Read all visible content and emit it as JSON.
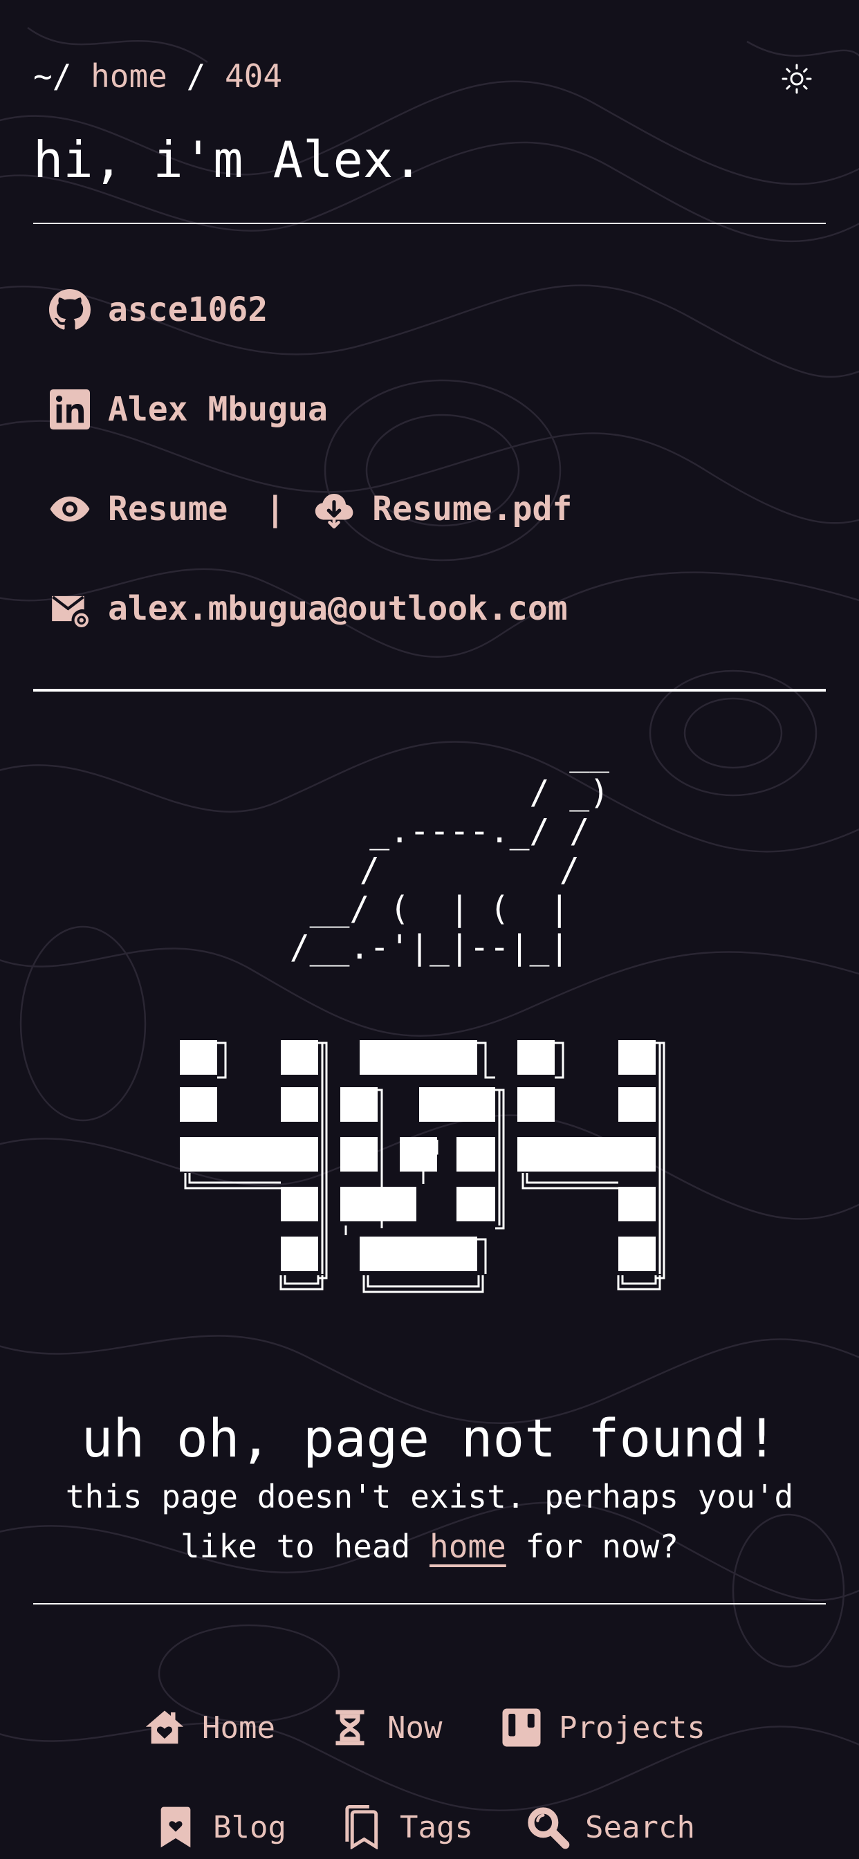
{
  "colors": {
    "background": "#12101a",
    "accent": "#e8c2bb",
    "text": "#ffffff"
  },
  "header": {
    "breadcrumb_prefix": "~/",
    "breadcrumb_home": "home",
    "breadcrumb_sep": "/",
    "breadcrumb_current": "404",
    "theme_toggle_icon": "sun-icon"
  },
  "intro": {
    "title": "hi, i'm Alex."
  },
  "links": {
    "github": {
      "icon": "github-icon",
      "label": "asce1062"
    },
    "linkedin": {
      "icon": "linkedin-icon",
      "label": "Alex Mbugua"
    },
    "resume": {
      "icon": "eye-icon",
      "label": "Resume"
    },
    "separator": "|",
    "resume_pdf": {
      "icon": "cloud-download-icon",
      "label": "Resume.pdf"
    },
    "email": {
      "icon": "email-icon",
      "label": "alex.mbugua@outlook.com"
    }
  },
  "ascii_art": "                __\n              / _)\n     _.----._/ /\n    /         /\n __/ (  | (  |\n/__.-'|_|--|_|",
  "ascii_logo_text": "404",
  "not_found": {
    "title": "uh oh, page not found!",
    "text_before": "this page doesn't exist. perhaps you'd like to head ",
    "link": "home",
    "text_after": " for now?"
  },
  "nav": {
    "items": [
      {
        "icon": "home-heart-icon",
        "label": "Home"
      },
      {
        "icon": "hourglass-icon",
        "label": "Now"
      },
      {
        "icon": "kanban-icon",
        "label": "Projects"
      },
      {
        "icon": "bookmark-icon",
        "label": "Blog"
      },
      {
        "icon": "bookmark-outline-icon",
        "label": "Tags"
      },
      {
        "icon": "search-icon",
        "label": "Search"
      }
    ]
  }
}
